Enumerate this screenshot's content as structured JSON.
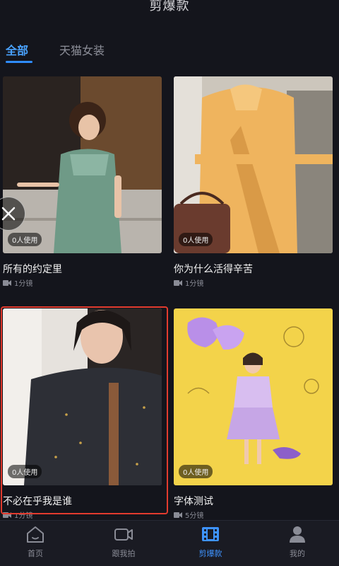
{
  "header": {
    "title": "剪爆款"
  },
  "tabs": [
    {
      "label": "全部",
      "active": true
    },
    {
      "label": "天猫女装",
      "active": false
    }
  ],
  "templates": [
    {
      "title": "所有的约定里",
      "usage": "0人使用",
      "meta": "1分镜"
    },
    {
      "title": "你为什么活得辛苦",
      "usage": "0人使用",
      "meta": "1分镜"
    },
    {
      "title": "不必在乎我是谁",
      "usage": "0人使用",
      "meta": "1分镜",
      "selected": true
    },
    {
      "title": "字体测试",
      "usage": "0人使用",
      "meta": "5分镜"
    }
  ],
  "bottom_nav": [
    {
      "label": "首页",
      "icon": "home-icon",
      "active": false
    },
    {
      "label": "跟我拍",
      "icon": "camera-icon",
      "active": false
    },
    {
      "label": "剪爆款",
      "icon": "film-icon",
      "active": true
    },
    {
      "label": "我的",
      "icon": "person-icon",
      "active": false
    }
  ],
  "colors": {
    "accent": "#2f8cff",
    "selection": "#e23b2e",
    "background": "#14151c"
  }
}
